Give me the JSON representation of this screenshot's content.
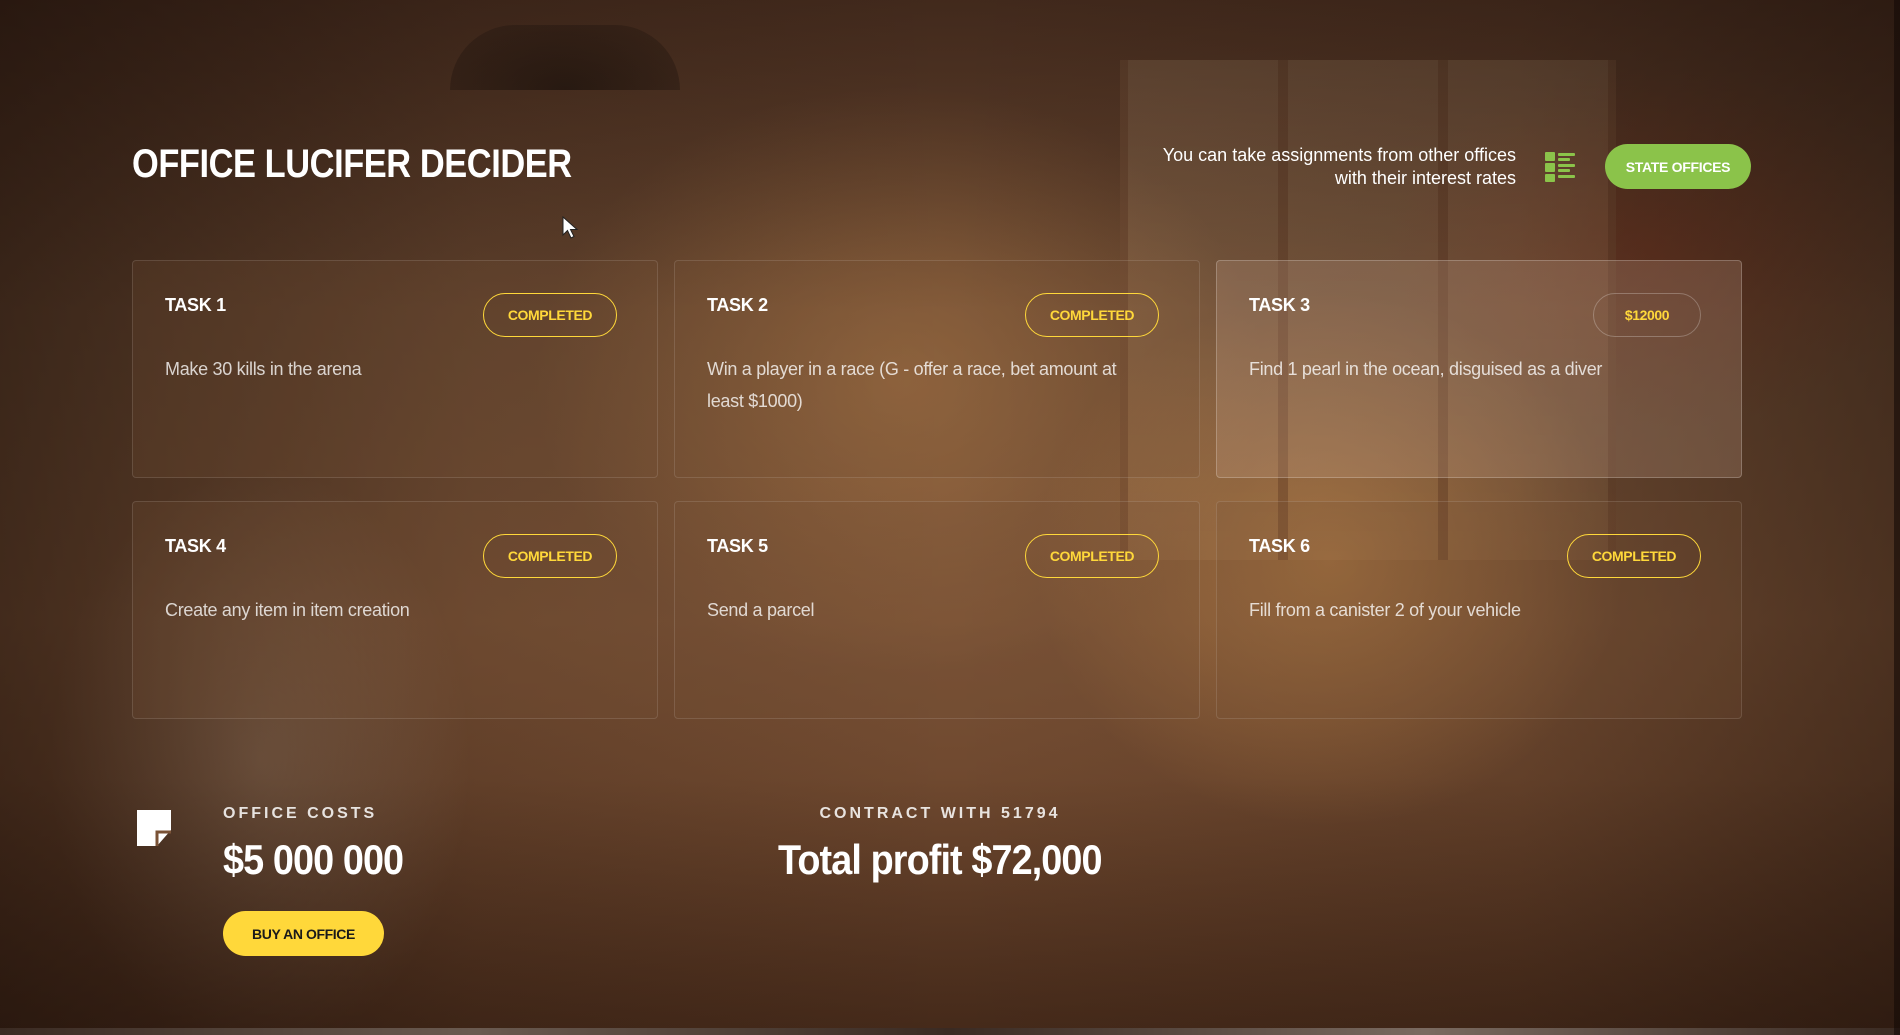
{
  "header": {
    "title": "OFFICE LUCIFER DECIDER",
    "info_line1": "You can take assignments from other offices",
    "info_line2": "with their interest rates",
    "list_icon": "list-grid-icon",
    "state_offices_label": "STATE OFFICES"
  },
  "tasks": [
    {
      "title": "TASK 1",
      "description": "Make 30 kills in the arena",
      "status": "COMPLETED"
    },
    {
      "title": "TASK 2",
      "description": "Win a player in a race (G - offer a race, bet amount at least $1000)",
      "status": "COMPLETED"
    },
    {
      "title": "TASK 3",
      "description": "Find 1 pearl in the ocean, disguised as a diver",
      "status": "$12000"
    },
    {
      "title": "TASK 4",
      "description": "Create any item in item creation",
      "status": "COMPLETED"
    },
    {
      "title": "TASK 5",
      "description": "Send a parcel",
      "status": "COMPLETED"
    },
    {
      "title": "TASK 6",
      "description": "Fill from a canister 2 of your vehicle",
      "status": "COMPLETED"
    }
  ],
  "footer": {
    "office_costs_label": "OFFICE COSTS",
    "office_costs_value": "$5 000 000",
    "buy_label": "BUY AN OFFICE",
    "contract_label": "CONTRACT WITH 51794",
    "profit_value": "Total profit $72,000",
    "note_icon": "sticky-note-icon"
  },
  "colors": {
    "accent_yellow": "#ffd83a",
    "accent_green": "#8bc34a"
  }
}
